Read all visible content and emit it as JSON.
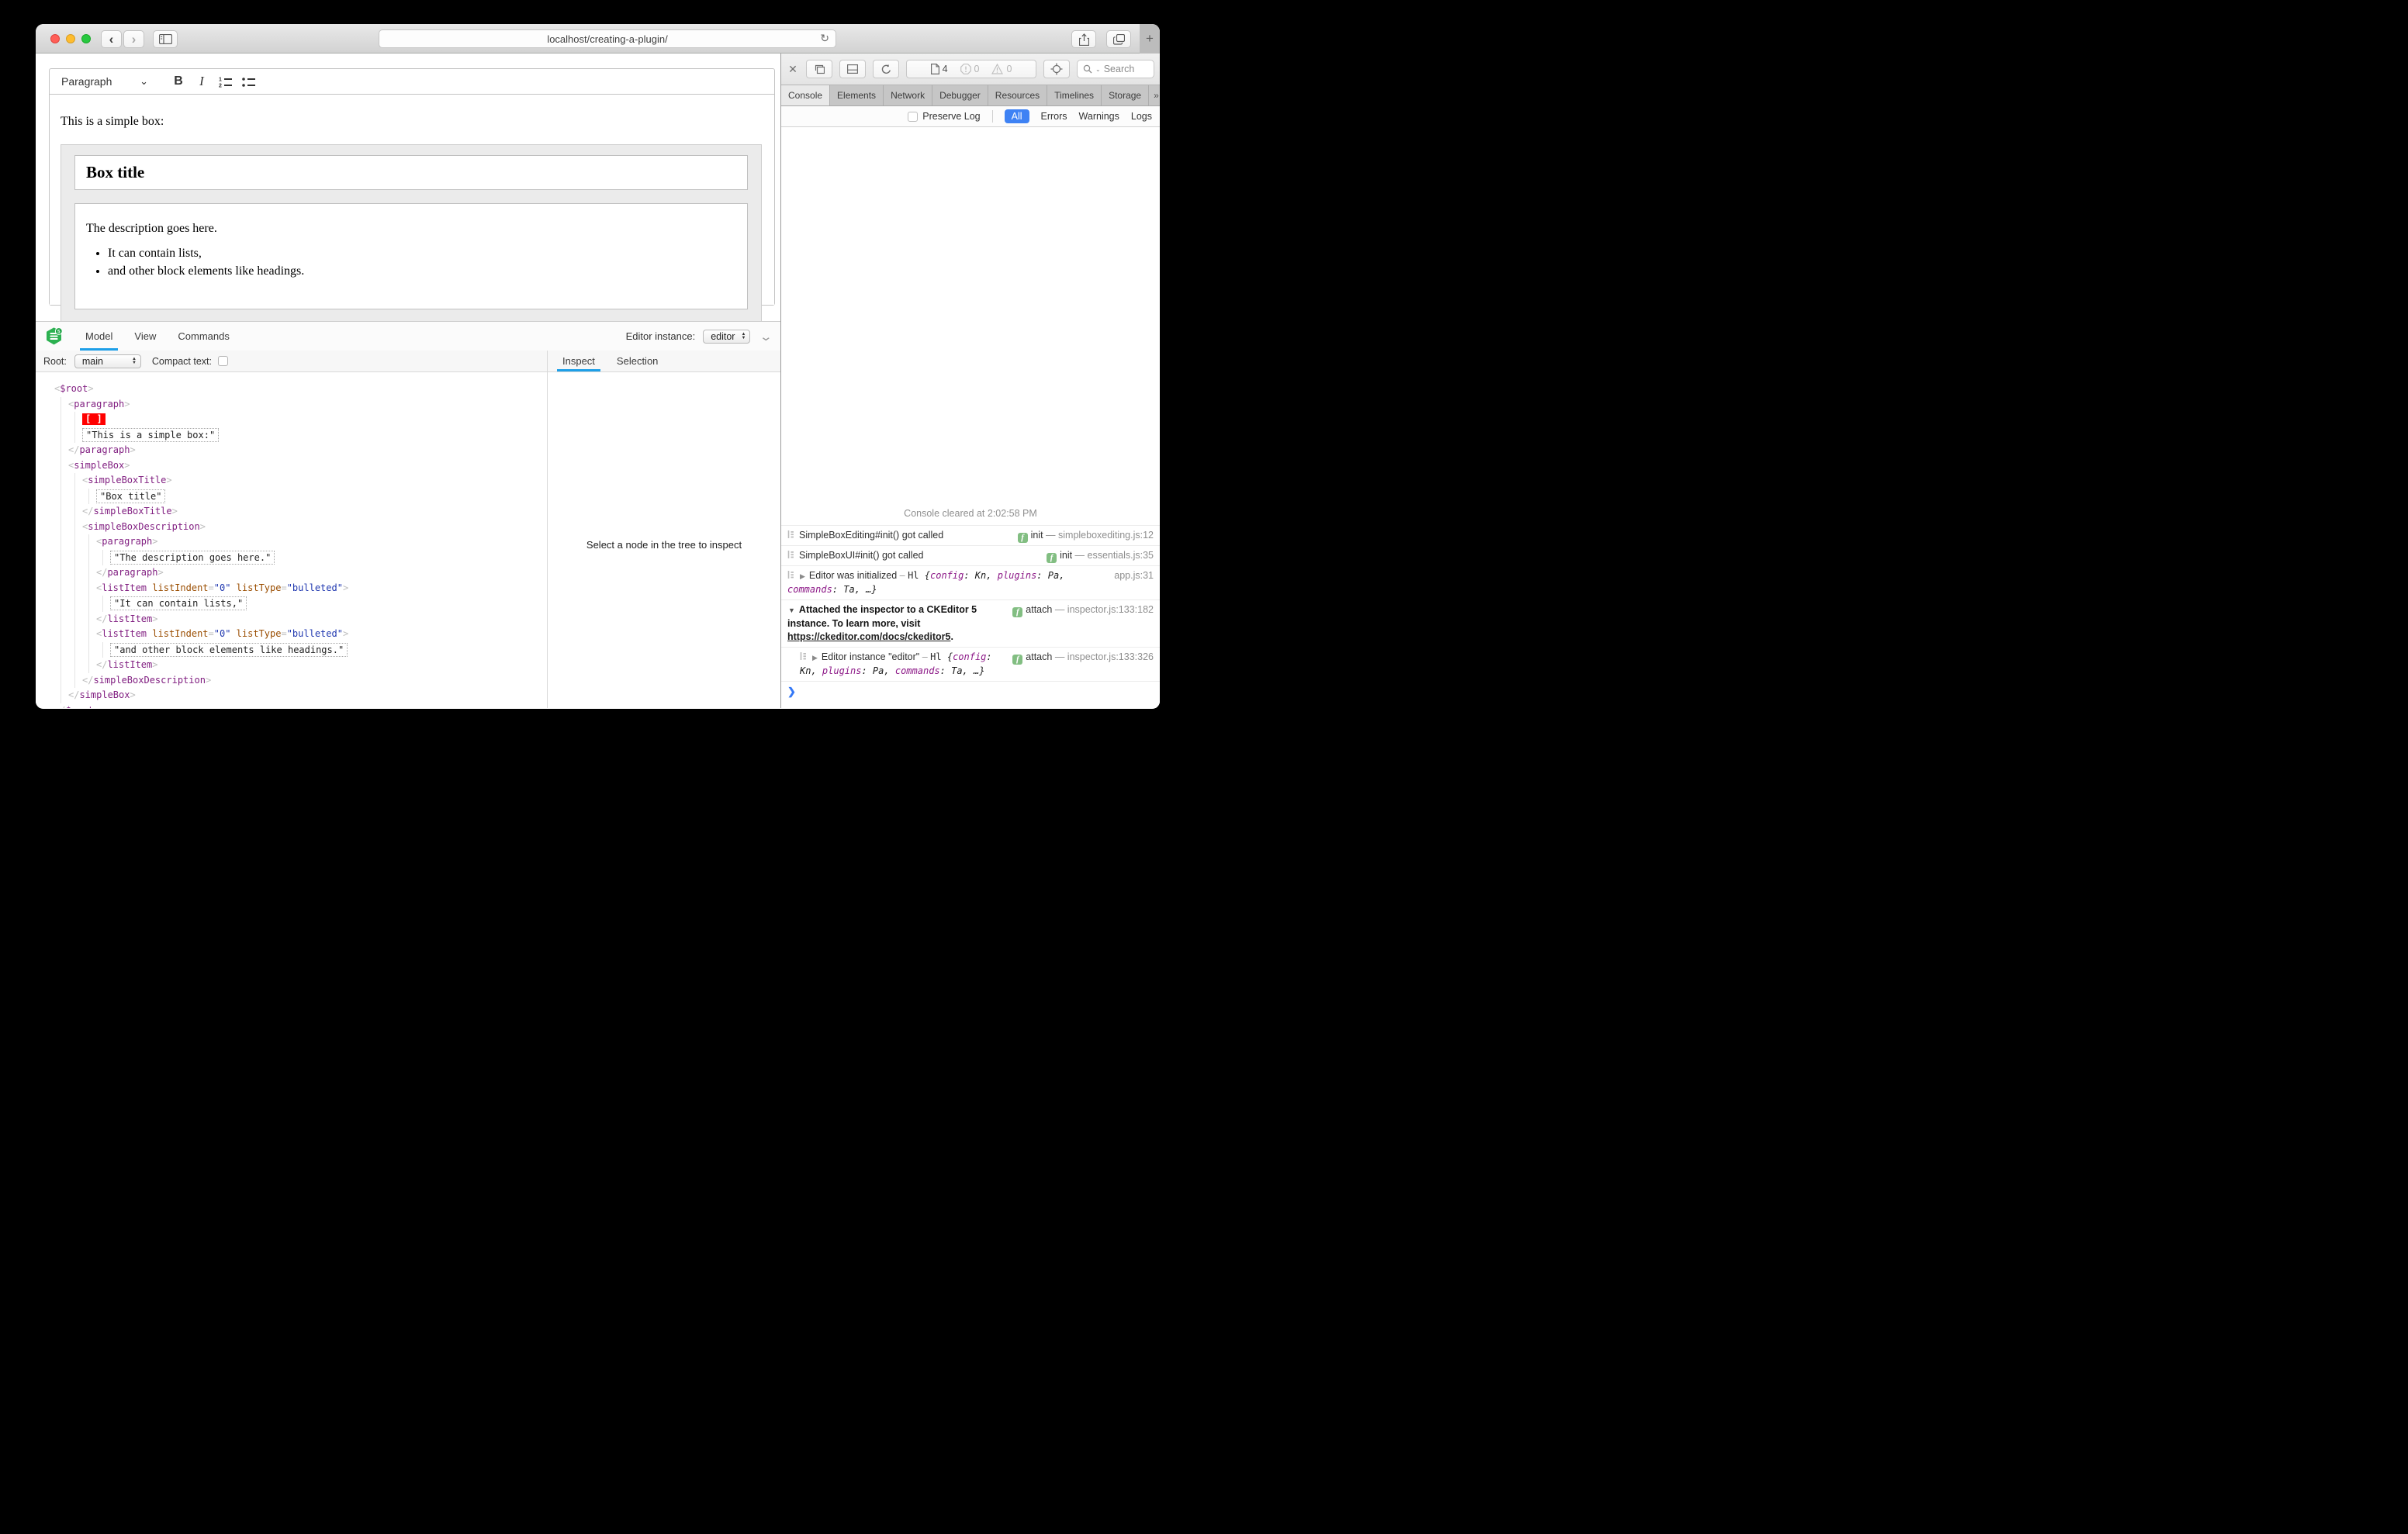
{
  "browser": {
    "url": "localhost/creating-a-plugin/"
  },
  "icons": {
    "back": "‹",
    "forward": "›",
    "plus": "+",
    "chevron_more": "»",
    "gear": "⚙",
    "close": "✕",
    "reload": "↻",
    "prompt": "❯",
    "dd_chevron": "⌄",
    "stepper_up": "▲",
    "stepper_down": "▼",
    "collapse_chevron": "⌄",
    "tri_right": "▶",
    "tri_down": "▼",
    "logo_badge": "5"
  },
  "colors": {
    "accent_tab_underline": "#1d9fe8",
    "filter_pill": "#3e82f4",
    "selection_marker": "#ff0000",
    "tag": "#811f81",
    "attr_name": "#9a4d00",
    "attr_value": "#2038b0",
    "badge_green": "#82be82",
    "logo_green": "#2cb151",
    "console_key": "#8d1a88"
  },
  "editor": {
    "toolbar": {
      "paragraph_label": "Paragraph",
      "bold_label": "B",
      "italic_label": "I"
    },
    "content": {
      "intro": "This is a simple box:",
      "box_title": "Box title",
      "box_description": "The description goes here.",
      "list_items": [
        "It can contain lists,",
        "and other block elements like headings."
      ]
    }
  },
  "inspector": {
    "tabs": [
      "Model",
      "View",
      "Commands"
    ],
    "active_tab": "Model",
    "editor_instance_label": "Editor instance:",
    "editor_instance_value": "editor",
    "root_label": "Root:",
    "root_value": "main",
    "compact_text_label": "Compact text:",
    "side_tabs": [
      "Inspect",
      "Selection"
    ],
    "active_side_tab": "Inspect",
    "placeholder": "Select a node in the tree to inspect",
    "tree": {
      "tag": "$root",
      "children": [
        {
          "tag": "paragraph",
          "children": [
            {
              "marker": "[ ]"
            },
            {
              "text": "\"This is a simple box:\""
            }
          ]
        },
        {
          "tag": "simpleBox",
          "children": [
            {
              "tag": "simpleBoxTitle",
              "children": [
                {
                  "text": "\"Box title\""
                }
              ]
            },
            {
              "tag": "simpleBoxDescription",
              "children": [
                {
                  "tag": "paragraph",
                  "children": [
                    {
                      "text": "\"The description goes here.\""
                    }
                  ]
                },
                {
                  "tag": "listItem",
                  "attrs": [
                    [
                      "listIndent",
                      "0"
                    ],
                    [
                      "listType",
                      "bulleted"
                    ]
                  ],
                  "children": [
                    {
                      "text": "\"It can contain lists,\""
                    }
                  ]
                },
                {
                  "tag": "listItem",
                  "attrs": [
                    [
                      "listIndent",
                      "0"
                    ],
                    [
                      "listType",
                      "bulleted"
                    ]
                  ],
                  "children": [
                    {
                      "text": "\"and other block elements like headings.\""
                    }
                  ]
                }
              ]
            }
          ]
        }
      ]
    }
  },
  "devtools": {
    "toolbar": {
      "resource_count": "4",
      "error_count": "0",
      "warning_count": "0",
      "search_label": "Search"
    },
    "tabs": [
      "Console",
      "Elements",
      "Network",
      "Debugger",
      "Resources",
      "Timelines",
      "Storage"
    ],
    "active_tab": "Console",
    "filter": {
      "preserve_log_label": "Preserve Log",
      "options": [
        "All",
        "Errors",
        "Warnings",
        "Logs"
      ],
      "active_option": "All"
    },
    "console": {
      "cleared_message": "Console cleared at 2:02:58 PM",
      "entries": [
        {
          "icon": true,
          "disclosure": null,
          "nested": false,
          "right": {
            "badge": true,
            "fn": "init",
            "link": "simpleboxediting.js:12"
          },
          "segs": [
            [
              "t",
              "SimpleBoxEditing#init() got called"
            ]
          ]
        },
        {
          "icon": true,
          "disclosure": null,
          "nested": false,
          "right": {
            "badge": true,
            "fn": "init",
            "link": "essentials.js:35"
          },
          "segs": [
            [
              "t",
              "SimpleBoxUI#init() got called"
            ]
          ]
        },
        {
          "icon": true,
          "disclosure": "r",
          "nested": false,
          "right": {
            "badge": false,
            "fn": null,
            "link": "app.js:31"
          },
          "segs": [
            [
              "t",
              "Editor was initialized"
            ],
            [
              "d",
              " – "
            ],
            [
              "m",
              "Hl "
            ],
            [
              "mi",
              "{"
            ],
            [
              "k",
              "config"
            ],
            [
              "mi",
              ": Kn, "
            ],
            [
              "k",
              "plugins"
            ],
            [
              "mi",
              ": Pa, "
            ],
            [
              "k",
              "commands"
            ],
            [
              "mi",
              ": Ta, …}"
            ]
          ]
        },
        {
          "icon": false,
          "disclosure": "d",
          "nested": false,
          "tall": true,
          "right": {
            "badge": true,
            "fn": "attach",
            "link": "inspector.js:133:182"
          },
          "segs": [
            [
              "b",
              "Attached the inspector to a CKEditor 5 instance. To learn more, visit "
            ],
            [
              "u",
              "https://ckeditor.com/docs/ckeditor5"
            ],
            [
              "b",
              "."
            ]
          ]
        },
        {
          "icon": true,
          "disclosure": "r",
          "nested": true,
          "right": {
            "badge": true,
            "fn": "attach",
            "link": "inspector.js:133:326"
          },
          "segs": [
            [
              "t",
              "Editor instance \"editor\""
            ],
            [
              "d",
              " – "
            ],
            [
              "m",
              "Hl "
            ],
            [
              "mi",
              "{"
            ],
            [
              "k",
              "config"
            ],
            [
              "mi",
              ": Kn, "
            ],
            [
              "k",
              "plugins"
            ],
            [
              "mi",
              ": Pa, "
            ],
            [
              "k",
              "commands"
            ],
            [
              "mi",
              ": Ta, …}"
            ]
          ]
        }
      ]
    }
  }
}
